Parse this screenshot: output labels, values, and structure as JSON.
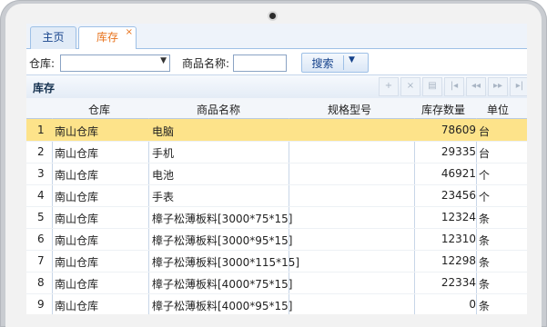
{
  "tabs": [
    {
      "label": "主页"
    },
    {
      "label": "库存",
      "close": "×"
    }
  ],
  "filters": {
    "warehouse_label": "仓库:",
    "warehouse_value": "",
    "product_label": "商品名称:",
    "product_value": "",
    "search_label": "搜索"
  },
  "panel": {
    "title": "库存",
    "tools": [
      "+",
      "×",
      "▤",
      "|◂",
      "◂◂",
      "▸▸",
      "▸|"
    ]
  },
  "grid": {
    "headers": [
      "仓库",
      "商品名称",
      "规格型号",
      "库存数量",
      "单位"
    ],
    "rows": [
      {
        "num": "1",
        "warehouse": "南山仓库",
        "name": "电脑",
        "spec": "",
        "qty": "78609",
        "unit": "台"
      },
      {
        "num": "2",
        "warehouse": "南山仓库",
        "name": "手机",
        "spec": "",
        "qty": "29335",
        "unit": "台"
      },
      {
        "num": "3",
        "warehouse": "南山仓库",
        "name": "电池",
        "spec": "",
        "qty": "46921",
        "unit": "个"
      },
      {
        "num": "4",
        "warehouse": "南山仓库",
        "name": "手表",
        "spec": "",
        "qty": "23456",
        "unit": "个"
      },
      {
        "num": "5",
        "warehouse": "南山仓库",
        "name": "樟子松薄板料[3000*75*15]",
        "spec": "",
        "qty": "12324",
        "unit": "条"
      },
      {
        "num": "6",
        "warehouse": "南山仓库",
        "name": "樟子松薄板料[3000*95*15]",
        "spec": "",
        "qty": "12310",
        "unit": "条"
      },
      {
        "num": "7",
        "warehouse": "南山仓库",
        "name": "樟子松薄板料[3000*115*15]",
        "spec": "",
        "qty": "12298",
        "unit": "条"
      },
      {
        "num": "8",
        "warehouse": "南山仓库",
        "name": "樟子松薄板料[4000*75*15]",
        "spec": "",
        "qty": "22334",
        "unit": "条"
      },
      {
        "num": "9",
        "warehouse": "南山仓库",
        "name": "樟子松薄板料[4000*95*15]",
        "spec": "",
        "qty": "0",
        "unit": "条"
      }
    ]
  },
  "colors": {
    "selected_row": "#fde38a",
    "accent": "#e8731c",
    "header_blue": "#15428b"
  }
}
